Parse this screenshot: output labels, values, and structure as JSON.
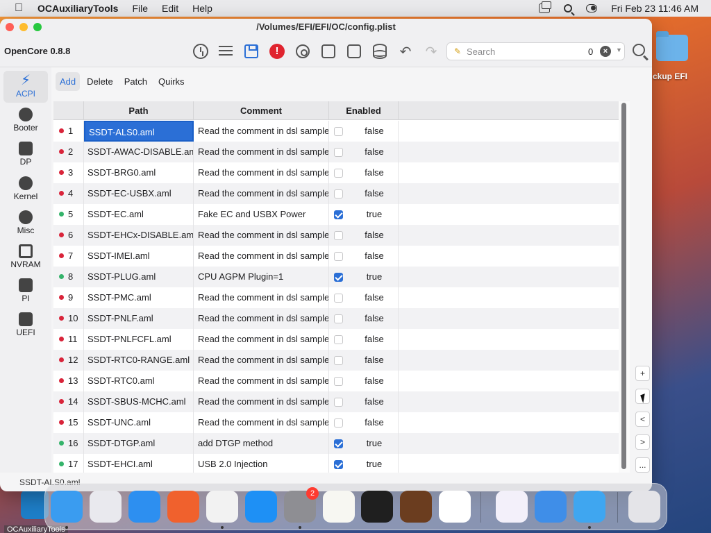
{
  "menubar": {
    "app_name": "OCAuxiliaryTools",
    "menus": [
      "File",
      "Edit",
      "Help"
    ],
    "datetime": "Fri Feb 23  11:46 AM"
  },
  "desktop": {
    "folder_label": "ckup EFI",
    "behind_app_label": "OCAuxiliaryTools"
  },
  "window": {
    "title": "/Volumes/EFI/EFI/OC/config.plist",
    "version": "OpenCore 0.8.8"
  },
  "search": {
    "placeholder": "Search",
    "count": "0"
  },
  "sidebar": {
    "items": [
      {
        "label": "ACPI",
        "icon": "acpi-icon",
        "active": true
      },
      {
        "label": "Booter",
        "icon": "booter-icon",
        "active": false
      },
      {
        "label": "DP",
        "icon": "device-properties-icon",
        "active": false
      },
      {
        "label": "Kernel",
        "icon": "kernel-icon",
        "active": false
      },
      {
        "label": "Misc",
        "icon": "misc-icon",
        "active": false
      },
      {
        "label": "NVRAM",
        "icon": "nvram-chip-icon",
        "active": false
      },
      {
        "label": "PI",
        "icon": "platform-info-apple-icon",
        "active": false
      },
      {
        "label": "UEFI",
        "icon": "uefi-cube-icon",
        "active": false
      }
    ]
  },
  "tabs": [
    {
      "label": "Add",
      "active": true
    },
    {
      "label": "Delete",
      "active": false
    },
    {
      "label": "Patch",
      "active": false
    },
    {
      "label": "Quirks",
      "active": false
    }
  ],
  "table": {
    "columns": [
      "",
      "Path",
      "Comment",
      "Enabled"
    ],
    "rows": [
      {
        "index": "1",
        "path": "SSDT-ALS0.aml",
        "comment": "Read the comment in dsl sample",
        "enabled": false,
        "enabled_text": "false"
      },
      {
        "index": "2",
        "path": "SSDT-AWAC-DISABLE.aml",
        "comment": "Read the comment in dsl sample",
        "enabled": false,
        "enabled_text": "false"
      },
      {
        "index": "3",
        "path": "SSDT-BRG0.aml",
        "comment": "Read the comment in dsl sample",
        "enabled": false,
        "enabled_text": "false"
      },
      {
        "index": "4",
        "path": "SSDT-EC-USBX.aml",
        "comment": "Read the comment in dsl sample",
        "enabled": false,
        "enabled_text": "false"
      },
      {
        "index": "5",
        "path": "SSDT-EC.aml",
        "comment": "Fake EC and USBX Power",
        "enabled": true,
        "enabled_text": "true"
      },
      {
        "index": "6",
        "path": "SSDT-EHCx-DISABLE.aml",
        "comment": "Read the comment in dsl sample",
        "enabled": false,
        "enabled_text": "false"
      },
      {
        "index": "7",
        "path": "SSDT-IMEI.aml",
        "comment": "Read the comment in dsl sample",
        "enabled": false,
        "enabled_text": "false"
      },
      {
        "index": "8",
        "path": "SSDT-PLUG.aml",
        "comment": "CPU AGPM Plugin=1",
        "enabled": true,
        "enabled_text": "true"
      },
      {
        "index": "9",
        "path": "SSDT-PMC.aml",
        "comment": "Read the comment in dsl sample",
        "enabled": false,
        "enabled_text": "false"
      },
      {
        "index": "10",
        "path": "SSDT-PNLF.aml",
        "comment": "Read the comment in dsl sample",
        "enabled": false,
        "enabled_text": "false"
      },
      {
        "index": "11",
        "path": "SSDT-PNLFCFL.aml",
        "comment": "Read the comment in dsl sample",
        "enabled": false,
        "enabled_text": "false"
      },
      {
        "index": "12",
        "path": "SSDT-RTC0-RANGE.aml",
        "comment": "Read the comment in dsl sample",
        "enabled": false,
        "enabled_text": "false"
      },
      {
        "index": "13",
        "path": "SSDT-RTC0.aml",
        "comment": "Read the comment in dsl sample",
        "enabled": false,
        "enabled_text": "false"
      },
      {
        "index": "14",
        "path": "SSDT-SBUS-MCHC.aml",
        "comment": "Read the comment in dsl sample",
        "enabled": false,
        "enabled_text": "false"
      },
      {
        "index": "15",
        "path": "SSDT-UNC.aml",
        "comment": "Read the comment in dsl sample",
        "enabled": false,
        "enabled_text": "false"
      },
      {
        "index": "16",
        "path": "SSDT-DTGP.aml",
        "comment": "add DTGP method",
        "enabled": true,
        "enabled_text": "true"
      },
      {
        "index": "17",
        "path": "SSDT-EHCI.aml",
        "comment": "USB 2.0 Injection",
        "enabled": true,
        "enabled_text": "true"
      }
    ],
    "selected_row": 0
  },
  "side_buttons": [
    "+",
    "",
    "<",
    ">",
    "..."
  ],
  "status_text": "SSDT-ALS0.aml",
  "colors": {
    "accent": "#2b6fd6",
    "dot_enabled": "#34b36a",
    "dot_disabled": "#d9243a"
  },
  "dock": {
    "apps": [
      {
        "icon": "finder-icon",
        "color": "#3a9cf0",
        "running": true
      },
      {
        "icon": "launchpad-icon",
        "color": "#e9e9ee",
        "running": false
      },
      {
        "icon": "safari-icon",
        "color": "#2d8ff0",
        "running": false
      },
      {
        "icon": "firefox-icon",
        "color": "#f0612d",
        "running": false
      },
      {
        "icon": "chrome-icon",
        "color": "#f2f2f2",
        "running": true
      },
      {
        "icon": "app-store-icon",
        "color": "#1e90f5",
        "running": false
      },
      {
        "icon": "system-settings-icon",
        "color": "#8e8e93",
        "running": true,
        "badge": "2"
      },
      {
        "icon": "textedit-icon",
        "color": "#f7f7f2",
        "running": false
      },
      {
        "icon": "terminal-icon",
        "color": "#1f1f1f",
        "running": false
      },
      {
        "icon": "garageband-icon",
        "color": "#6b3d1f",
        "running": false
      },
      {
        "icon": "vscode-icon",
        "color": "#ffffff",
        "running": false
      },
      {
        "icon": "visual-studio-icon",
        "color": "#f3f0fa",
        "running": false
      },
      {
        "icon": "weather-icon",
        "color": "#3f8ee8",
        "running": false
      },
      {
        "icon": "ocauxiliarytools-icon",
        "color": "#3fa6f0",
        "running": true
      },
      {
        "icon": "trash-icon",
        "color": "#e4e4e8",
        "running": false
      }
    ]
  }
}
